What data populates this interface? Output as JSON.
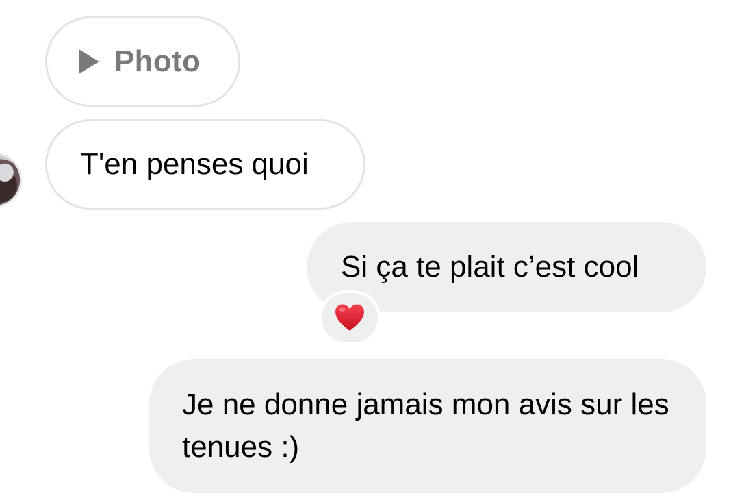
{
  "messages": {
    "photo": {
      "label": "Photo",
      "icon": "play-icon"
    },
    "incoming_text": "T'en penses quoi",
    "outgoing_1": "Si ça te plait c’est cool",
    "outgoing_2": "Je ne donne jamais mon avis sur les tenues :)"
  },
  "reaction": {
    "icon": "heart-icon",
    "color": "#e0162b"
  },
  "colors": {
    "incoming_border": "#e3e3e3",
    "outgoing_bg": "#efefef",
    "muted_text": "#7a7a7a"
  }
}
